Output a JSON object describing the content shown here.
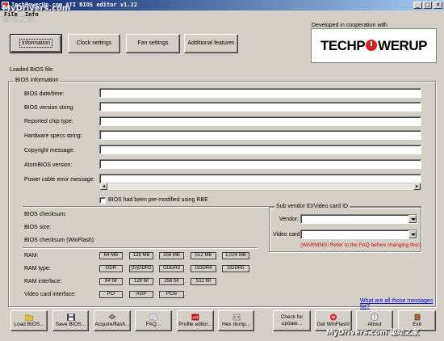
{
  "window": {
    "title": "TechPowerUp.com  ATI BIOS editor v1.22",
    "min": "_",
    "max": "□",
    "close": "✕"
  },
  "menu": [
    "File",
    "Info"
  ],
  "tabs": [
    {
      "label": "Information",
      "active": true
    },
    {
      "label": "Clock settings",
      "active": false
    },
    {
      "label": "Fan settings",
      "active": false
    },
    {
      "label": "Additional features",
      "active": false
    }
  ],
  "logo": {
    "caption": "Developed in cooperation with",
    "text_before": "TECHP",
    "text_after": "WERUP"
  },
  "loaded_label": "Loaded BIOS file:",
  "bios_info": {
    "title": "BIOS information",
    "fields": [
      {
        "label": "BIOS date/time:",
        "value": ""
      },
      {
        "label": "BIOS version string:",
        "value": ""
      },
      {
        "label": "Reported chip type:",
        "value": ""
      },
      {
        "label": "Hardware specs string:",
        "value": ""
      },
      {
        "label": "Copyright message:",
        "value": ""
      },
      {
        "label": "AtomBIOS version:",
        "value": ""
      },
      {
        "label": "Power cable error message:",
        "value": ""
      }
    ],
    "premodified_label": "BIOS had been pre-modified using RBE",
    "premodified_checked": false,
    "checksum_label": "BIOS checksum:",
    "size_label": "BIOS size:",
    "checksum_winflash_label": "BIOS checksum (WinFlash):",
    "ram_label": "RAM:",
    "ram_values": [
      "64 MB",
      "128 MB",
      "256 MB",
      "512 MB",
      "1,024 MB"
    ],
    "ram_type_label": "RAM type:",
    "ram_type_values": [
      "DDR",
      "(G)DDR2",
      "GDDR3",
      "GDDR4",
      "GDDR5"
    ],
    "ram_interface_label": "RAM interface:",
    "ram_interface_values": [
      "64 bit",
      "128 bit",
      "256 bit",
      "512 bit"
    ],
    "video_interface_label": "Video card interface:",
    "video_interface_values": [
      "PCI",
      "AGP",
      "PCIe"
    ]
  },
  "subvendor": {
    "title": "Sub vendor ID/Video card ID",
    "vendor_label": "Vendor:",
    "vendor_value": "",
    "videocard_label": "Video card:",
    "videocard_value": "",
    "warning": "(WARNING! Refer to the FAQ before changing this!)"
  },
  "faq_link": "What are all those messages for?",
  "toolbar": [
    {
      "label": "Load BIOS...",
      "icon": "folder-icon"
    },
    {
      "label": "Save BIOS...",
      "icon": "floppy-icon"
    },
    {
      "label": "Acquire/flash...",
      "icon": "chip-icon"
    },
    {
      "label": "FAQ...",
      "icon": "faq-icon"
    },
    {
      "label": "Profile editor...",
      "icon": "ati-icon"
    },
    {
      "label": "Hex dump...",
      "icon": "hex-icon"
    },
    {
      "label": "Check for update...",
      "icon": "update-icon"
    },
    {
      "label": "Get WinFlash!",
      "icon": "winflash-icon"
    },
    {
      "label": "About",
      "icon": "info-icon"
    },
    {
      "label": "Exit",
      "icon": "exit-icon"
    }
  ],
  "watermarks": {
    "top_line1": "MyDrivers.com",
    "top_line2": "驱动之家",
    "bottom": "MyDrivers.com  驱动之家"
  },
  "colors": {
    "titlebar_start": "#0a246a",
    "titlebar_end": "#a6caf0",
    "window_bg": "#d4d0c8",
    "warning": "#d00000",
    "link": "#0000cc",
    "logo_power": "#d42020"
  }
}
